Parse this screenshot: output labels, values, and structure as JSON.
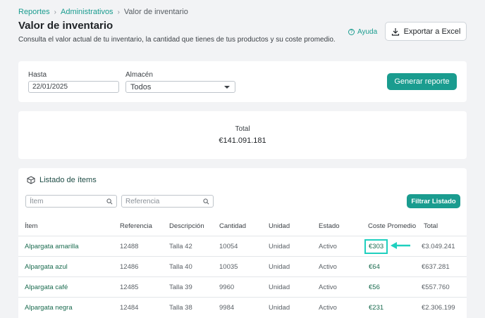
{
  "breadcrumb": {
    "items": [
      "Reportes",
      "Administrativos",
      "Valor de inventario"
    ]
  },
  "page": {
    "title": "Valor de inventario",
    "subtitle": "Consulta el valor actual de tu inventario, la cantidad que tienes de tus productos y su coste promedio.",
    "help_label": "Ayuda",
    "export_label": "Exportar a Excel"
  },
  "filters": {
    "hasta_label": "Hasta",
    "hasta_value": "22/01/2025",
    "almacen_label": "Almacén",
    "almacen_value": "Todos",
    "generate_label": "Generar reporte"
  },
  "total": {
    "label": "Total",
    "value": "€141.091.181"
  },
  "list": {
    "title": "Listado de ítems",
    "item_placeholder": "Ítem",
    "ref_placeholder": "Referencia",
    "filter_label": "Filtrar Listado",
    "columns": [
      "Ítem",
      "Referencia",
      "Descripción",
      "Cantidad",
      "Unidad",
      "Estado",
      "Coste Promedio",
      "Total"
    ],
    "rows": [
      [
        "Alpargata amarilla",
        "12488",
        "Talla 42",
        "10054",
        "Unidad",
        "Activo",
        "€303",
        "€3.049.241"
      ],
      [
        "Alpargata azul",
        "12486",
        "Talla 40",
        "10035",
        "Unidad",
        "Activo",
        "€64",
        "€637.281"
      ],
      [
        "Alpargata café",
        "12485",
        "Talla 39",
        "9960",
        "Unidad",
        "Activo",
        "€56",
        "€557.760"
      ],
      [
        "Alpargata negra",
        "12484",
        "Talla 38",
        "9984",
        "Unidad",
        "Activo",
        "€231",
        "€2.306.199"
      ]
    ]
  },
  "colors": {
    "accent": "#1a9c8f",
    "highlight": "#1fd0bf",
    "background": "#f2f3f5"
  }
}
